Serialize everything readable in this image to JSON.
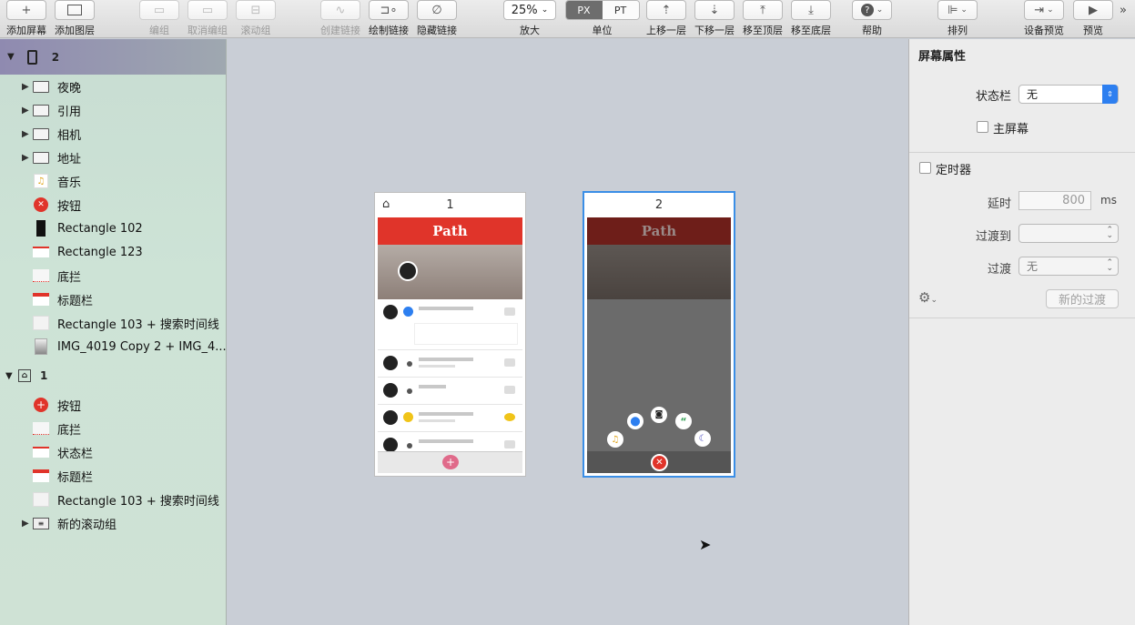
{
  "toolbar": {
    "add_screen": "添加屏幕",
    "add_layer": "添加图层",
    "group": "编组",
    "ungroup": "取消编组",
    "scroll_group": "滚动组",
    "create_link": "创建链接",
    "draw_link": "绘制链接",
    "hide_link": "隐藏链接",
    "zoom_value": "25%",
    "zoom_label": "放大",
    "unit_px": "PX",
    "unit_pt": "PT",
    "unit_label": "单位",
    "move_up": "上移一层",
    "move_down": "下移一层",
    "move_top": "移至顶层",
    "move_bottom": "移至底层",
    "help": "帮助",
    "arrange": "排列",
    "device_preview": "设备预览",
    "preview": "预览"
  },
  "layers": {
    "screen2": {
      "name": "2",
      "items": [
        {
          "label": "夜晚",
          "icon": "folder-icon",
          "expandable": true
        },
        {
          "label": "引用",
          "icon": "folder-icon",
          "expandable": true
        },
        {
          "label": "相机",
          "icon": "folder-icon",
          "expandable": true
        },
        {
          "label": "地址",
          "icon": "folder-icon",
          "expandable": true
        },
        {
          "label": "音乐",
          "icon": "music-icon",
          "expandable": false
        },
        {
          "label": "按钮",
          "icon": "close-button-icon",
          "expandable": false
        },
        {
          "label": "Rectangle 102",
          "icon": "black-rect-icon",
          "expandable": false
        },
        {
          "label": "Rectangle 123",
          "icon": "red-line-icon",
          "expandable": false
        },
        {
          "label": "底拦",
          "icon": "bottom-bar-icon",
          "expandable": false
        },
        {
          "label": "标题栏",
          "icon": "title-bar-icon",
          "expandable": false
        },
        {
          "label": "Rectangle 103 + 搜索时间线",
          "icon": "blank-rect-icon",
          "expandable": false
        },
        {
          "label": "IMG_4019 Copy 2 + IMG_4...",
          "icon": "image-icon",
          "expandable": false
        }
      ]
    },
    "screen1": {
      "name": "1",
      "items": [
        {
          "label": "按钮",
          "icon": "add-button-icon",
          "expandable": false
        },
        {
          "label": "底拦",
          "icon": "bottom-bar-icon",
          "expandable": false
        },
        {
          "label": "状态栏",
          "icon": "red-line-icon",
          "expandable": false
        },
        {
          "label": "标题栏",
          "icon": "title-bar-icon",
          "expandable": false
        },
        {
          "label": "Rectangle 103 + 搜索时间线",
          "icon": "blank-rect-icon",
          "expandable": false
        },
        {
          "label": "新的滚动组",
          "icon": "scroll-group-icon",
          "expandable": true
        }
      ]
    }
  },
  "canvas": {
    "artboard1_title": "1",
    "artboard2_title": "2",
    "app_title": "Path"
  },
  "inspector": {
    "title": "屏幕属性",
    "status_bar_label": "状态栏",
    "status_bar_value": "无",
    "home_screen_label": "主屏幕",
    "timer_label": "定时器",
    "delay_label": "延时",
    "delay_value": "800",
    "delay_unit": "ms",
    "transition_to_label": "过渡到",
    "transition_to_value": "",
    "transition_label": "过渡",
    "transition_value": "无",
    "new_transition_button": "新的过渡"
  },
  "colors": {
    "accent": "#2d7ff0",
    "path_red": "#e0342a",
    "selection_blue": "#3a8ee6"
  }
}
